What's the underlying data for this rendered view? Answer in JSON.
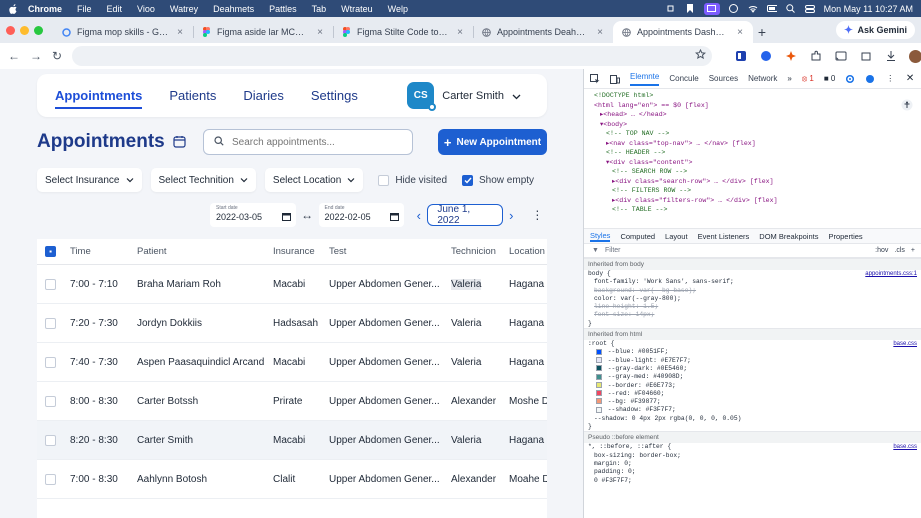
{
  "menubar": {
    "app": "Chrome",
    "items": [
      "File",
      "Edit",
      "Vioo",
      "Watrey",
      "Deahmets",
      "Pattles",
      "Tab",
      "Wtrateu",
      "Welp"
    ],
    "datetime": "Mon May 11  10:27 AM"
  },
  "browser": {
    "tabs": [
      {
        "label": "Figma mop skills - Google Sec",
        "icon": "google-icon"
      },
      {
        "label": "Figma aside lar MCP - Figma",
        "icon": "figma-icon"
      },
      {
        "label": "Figma Stilte Code to Design",
        "icon": "figma-icon"
      },
      {
        "label": "Appointments Deahbsard",
        "icon": "globe-icon"
      },
      {
        "label": "Appointments Dashboard",
        "icon": "globe-icon",
        "active": true
      }
    ],
    "gemini_label": "Ask Gemini"
  },
  "app": {
    "nav": [
      {
        "label": "Appointments",
        "active": true
      },
      {
        "label": "Patients"
      },
      {
        "label": "Diaries"
      },
      {
        "label": "Settings"
      }
    ],
    "user": {
      "initials": "CS",
      "name": "Carter Smith"
    },
    "page_title": "Appointments",
    "search_placeholder": "Search appointments...",
    "new_button": "New Appointment",
    "filters": {
      "insurance": "Select Insurance",
      "technician": "Select Technition",
      "location": "Select Location",
      "hide_visited": "Hide visited",
      "show_empty": "Show empty"
    },
    "dates": {
      "start_label": "Start date",
      "start": "2022-03-05",
      "end_label": "End date",
      "end": "2022-02-05",
      "current": "June 1, 2022"
    },
    "table": {
      "columns": [
        "Time",
        "Patient",
        "Insurance",
        "Test",
        "Technicion",
        "Location"
      ],
      "rows": [
        {
          "time": "7:00 - 7:10",
          "patient": "Braha Mariam Roh",
          "insurance": "Macabi",
          "test": "Upper Abdomen Gener...",
          "tech": "Valeria",
          "location": "Hagana 1("
        },
        {
          "time": "7:20 - 7:30",
          "patient": "Jordyn Dokkiis",
          "insurance": "Hadsasah",
          "test": "Upper Abdomen Gener...",
          "tech": "Valeria",
          "location": "Hagana 1("
        },
        {
          "time": "7:40 - 7:30",
          "patient": "Aspen Paasaquindicl Arcand",
          "insurance": "Macabi",
          "test": "Upper Abdomen Gener...",
          "tech": "Valeria",
          "location": "Hagana 1("
        },
        {
          "time": "8:00 - 8:30",
          "patient": "Carter Botssh",
          "insurance": "Prirate",
          "test": "Upper Abdomen Gener...",
          "tech": "Alexander",
          "location": "Moshe Di"
        },
        {
          "time": "8:20 - 8:30",
          "patient": "Carter Smith",
          "insurance": "Macabi",
          "test": "Upper Abdomen Gener...",
          "tech": "Valeria",
          "location": "Hagana 1("
        },
        {
          "time": "7:00 - 8:30",
          "patient": "Aahlynn Botosh",
          "insurance": "Clalit",
          "test": "Upper Abdomen Gener...",
          "tech": "Alexander",
          "location": "Moahe D"
        }
      ]
    }
  },
  "devtools": {
    "tabs": [
      "Elemnte",
      "Concule",
      "Sources",
      "Network"
    ],
    "errors": "1",
    "warnings": "0",
    "element_lines": [
      "<!DOCTYPE html>",
      "<html lang=\"en\"> == $0 [flex]",
      "▸<head> … </head>",
      "▾<body>",
      "  <!-- TOP NAV -->",
      "  ▸<nav class=\"top-nav\"> … </nav> [flex]",
      "  <!-- HEADER -->",
      "  ▾<div class=\"content\">",
      "    <!-- SEARCH ROW -->",
      "    ▸<div class=\"search-row\"> … </div> [flex]",
      "    <!-- FILTERS ROW -->",
      "    ▸<div class=\"filters-row\"> … </div> [flex]",
      "    <!-- TABLE -->"
    ],
    "style_tabs": [
      "Styles",
      "Computed",
      "Layout",
      "Event Listeners",
      "DOM Breakpoints",
      "Properties"
    ],
    "filter_placeholder": "Filter",
    "filter_tools": [
      ":hov",
      ".cls",
      "+"
    ],
    "inherited_body": "Inherited from body",
    "body_src": "appointments.css:1",
    "body_lines": [
      "body {",
      "  font-family: 'Work Sans', sans-serif;",
      "  background: var(--bg-base);",
      "  color: var(--gray-800);",
      "  line-height: 1.5;",
      "  font-size: 14px;",
      "}"
    ],
    "inherited_html": "Inherited from html",
    "root_src": "base.css",
    "root_lines": [
      ":root {",
      "  --blue: #0051FF;",
      "  --blue-light: #E7E7F7;",
      "  --gray-dark: #0E5460;",
      "  --gray-med: #40908D;",
      "  --border: #E6E773;",
      "  --red: #F04660;",
      "  --bg: #F39877;",
      "  --shadow: #F3F7F7;",
      "  --shadow: 0 4px 2px rgba(0, 0, 0, 0.05)",
      "}"
    ],
    "pseudo_h": "Pseudo ::before element",
    "pseudo_src": "base.css",
    "pseudo_lines": [
      "*, ::before, ::after {",
      "  box-sizing: border-box;",
      "  margin: 0;",
      "  padding: 0;",
      "  0  #F3F7F7;"
    ]
  }
}
